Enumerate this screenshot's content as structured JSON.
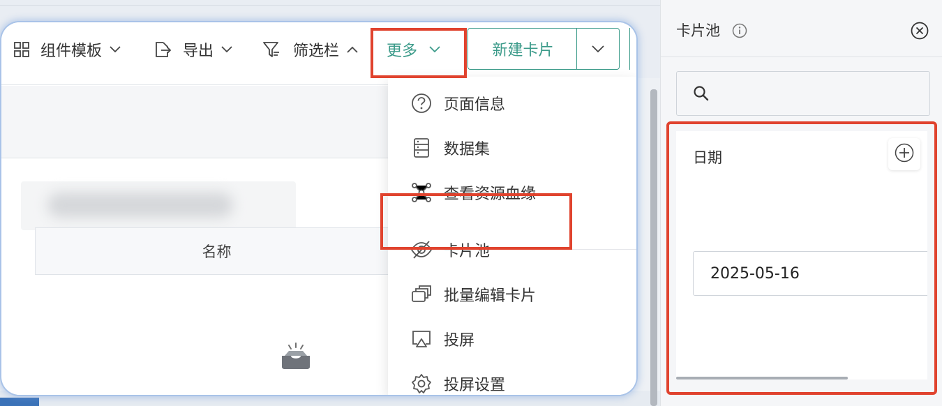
{
  "toolbar": {
    "templates_label": "组件模板",
    "export_label": "导出",
    "filter_label": "筛选栏",
    "more_label": "更多",
    "new_card_label": "新建卡片"
  },
  "table": {
    "header_name": "名称"
  },
  "menu": {
    "items": [
      {
        "label": "页面信息",
        "icon": "question-circle-icon"
      },
      {
        "label": "数据集",
        "icon": "dataset-icon"
      },
      {
        "label": "查看资源血缘",
        "icon": "lineage-icon"
      },
      {
        "label": "卡片池",
        "icon": "eye-off-icon"
      },
      {
        "label": "批量编辑卡片",
        "icon": "batch-edit-icon"
      },
      {
        "label": "投屏",
        "icon": "screencast-icon"
      },
      {
        "label": "投屏设置",
        "icon": "gear-icon"
      }
    ]
  },
  "panel": {
    "title": "卡片池",
    "search_placeholder": "",
    "date_card": {
      "label": "日期",
      "value": "2025-05-16"
    }
  },
  "colors": {
    "accent": "#3c9b8a",
    "highlight": "#e0432e"
  }
}
